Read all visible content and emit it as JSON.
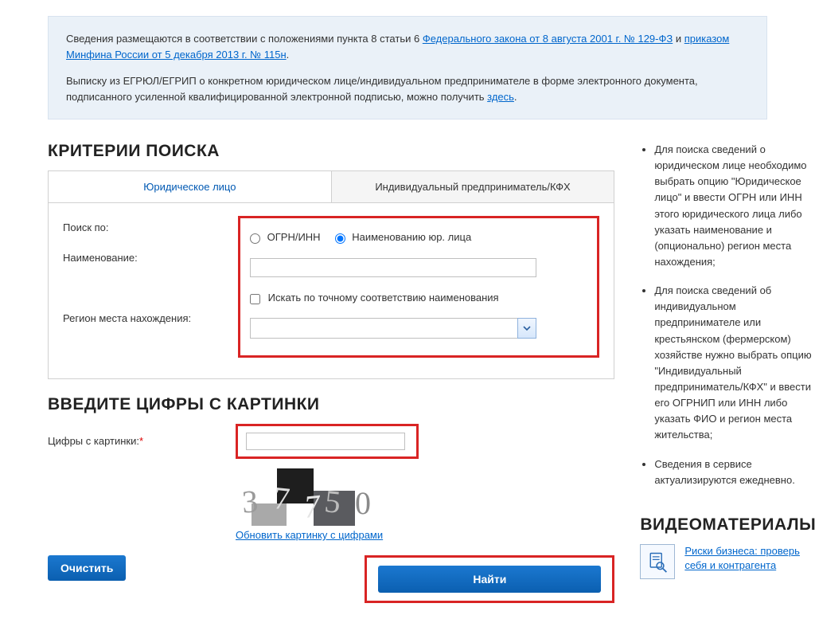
{
  "info": {
    "line1_prefix": "Сведения размещаются в соответствии с положениями пункта 8 статьи 6 ",
    "law_link": "Федерального закона от 8 августа 2001 г. № 129-ФЗ",
    "line1_and": " и ",
    "order_link": "приказом Минфина России от 5 декабря 2013 г. № 115н",
    "line1_end": ".",
    "line2_prefix": "Выписку из ЕГРЮЛ/ЕГРИП о конкретном юридическом лице/индивидуальном предпринимателе в форме электронного документа, подписанного усиленной квалифицированной электронной подписью, можно получить ",
    "here_link": "здесь",
    "line2_end": "."
  },
  "sections": {
    "criteria": "КРИТЕРИИ ПОИСКА",
    "captcha": "ВВЕДИТЕ ЦИФРЫ С КАРТИНКИ",
    "video": "ВИДЕОМАТЕРИАЛЫ"
  },
  "tabs": {
    "legal": "Юридическое лицо",
    "ip": "Индивидуальный предприниматель/КФХ"
  },
  "form": {
    "search_by": "Поиск по:",
    "radio_ogrn": "ОГРН/ИНН",
    "radio_name": "Наименованию юр. лица",
    "name_label": "Наименование:",
    "exact": "Искать по точному соответствию наименования",
    "region_label": "Регион места нахождения:"
  },
  "captcha": {
    "label": "Цифры с картинки:",
    "refresh": "Обновить картинку с цифрами",
    "digits": [
      "3",
      "7",
      "7",
      "5",
      "0"
    ]
  },
  "buttons": {
    "clear": "Очистить",
    "find": "Найти"
  },
  "help": {
    "items": [
      "Для поиска сведений о юридическом лице необходимо выбрать опцию \"Юридическое лицо\" и ввести ОГРН или ИНН этого юридического лица либо указать наименование и (опционально) регион места нахождения;",
      "Для поиска сведений об индивидуальном предпринимателе или крестьянском (фермерском) хозяйстве нужно выбрать опцию \"Индивидуальный предприниматель/КФХ\" и ввести его ОГРНИП или ИНН либо указать ФИО и регион места жительства;",
      "Сведения в сервисе актуализируются ежедневно."
    ]
  },
  "video": {
    "link": "Риски бизнеса: проверь себя и контрагента"
  }
}
